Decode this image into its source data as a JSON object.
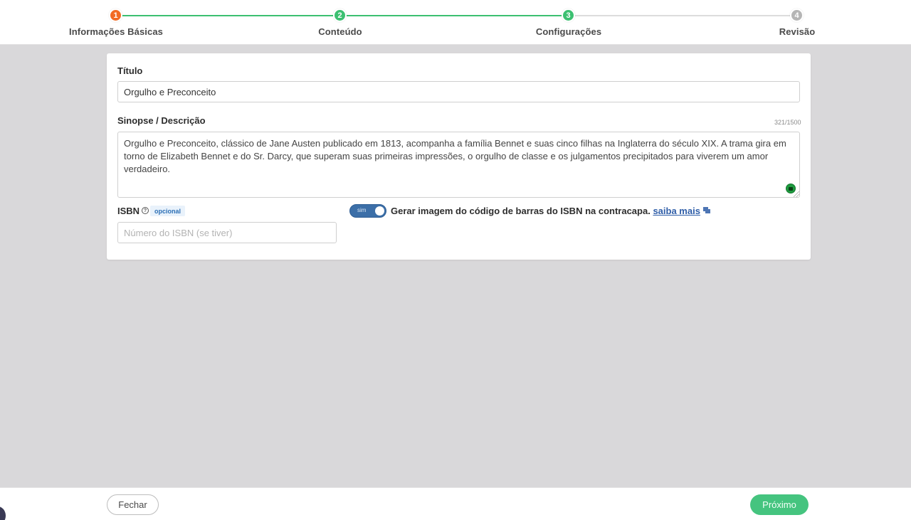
{
  "stepper": {
    "steps": [
      {
        "number": "1",
        "label": "Informações Básicas",
        "state": "current",
        "color": "#f26b24"
      },
      {
        "number": "2",
        "label": "Conteúdo",
        "state": "done",
        "color": "#3cc071"
      },
      {
        "number": "3",
        "label": "Configurações",
        "state": "done",
        "color": "#3cc071"
      },
      {
        "number": "4",
        "label": "Revisão",
        "state": "todo",
        "color": "#b5b5b5"
      }
    ]
  },
  "form": {
    "title_label": "Título",
    "title_value": "Orgulho e Preconceito",
    "synopsis_label": "Sinopse / Descrição",
    "synopsis_counter": "321/1500",
    "synopsis_value": "Orgulho e Preconceito, clássico de Jane Austen publicado em 1813, acompanha a família Bennet e suas cinco filhas na Inglaterra do século XIX. A trama gira em torno de Elizabeth Bennet e do Sr. Darcy, que superam suas primeiras impressões, o orgulho de classe e os julgamentos precipitados para viverem um amor verdadeiro.",
    "isbn_label": "ISBN",
    "isbn_help_glyph": "?",
    "isbn_optional_badge": "opcional",
    "isbn_placeholder": "Número do ISBN (se tiver)",
    "isbn_value": "",
    "barcode_toggle_state": "sim",
    "barcode_toggle_on": true,
    "barcode_caption": "Gerar imagem do código de barras do ISBN na contracapa.",
    "barcode_link": "saiba mais"
  },
  "footer": {
    "close_label": "Fechar",
    "next_label": "Próximo"
  },
  "colors": {
    "accent_green": "#45c47f",
    "step_current": "#f26b24",
    "toggle_blue": "#3c6fa8",
    "background": "#d9d8da"
  }
}
